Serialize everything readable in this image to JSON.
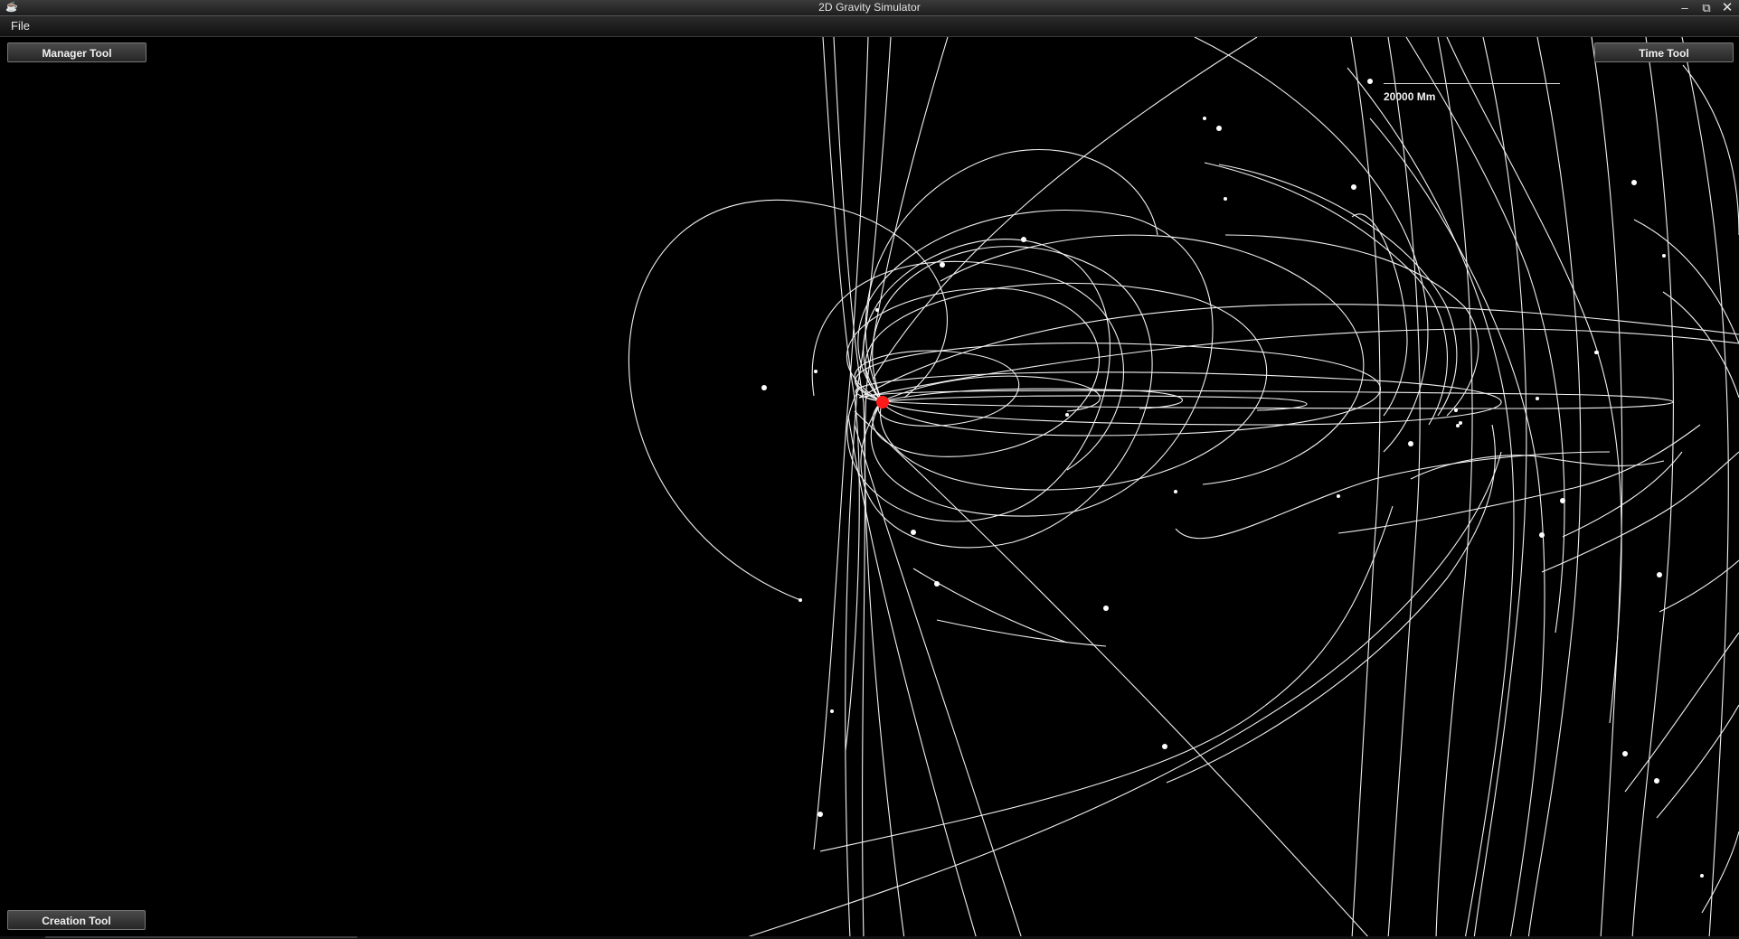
{
  "window": {
    "title": "2D Gravity Simulator",
    "app_icon": "coffee-cup-icon",
    "controls": {
      "minimize": "–",
      "maximize": "⧉",
      "close": "✕"
    }
  },
  "menu": {
    "file_label": "File"
  },
  "tools": {
    "manager_label": "Manager Tool",
    "time_label": "Time Tool",
    "creation_label": "Creation Tool"
  },
  "scale": {
    "label": "20000 Mm"
  },
  "colors": {
    "background": "#000000",
    "trail": "#ffffff",
    "central_body": "#ff1a1a"
  }
}
